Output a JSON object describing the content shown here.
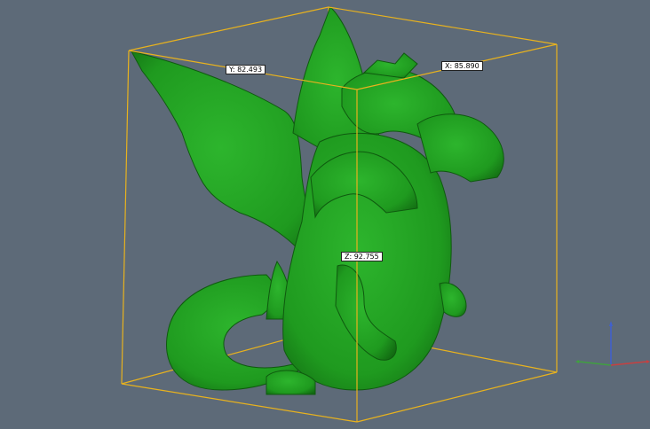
{
  "viewport": {
    "background_color": "#5d6a78",
    "model_color": "#1f9a1f",
    "bbox_color": "#e8b21e"
  },
  "dimensions": {
    "x_label": "X: 85.890",
    "y_label": "Y: 82.493",
    "z_label": "Z: 92.755"
  },
  "axis_gizmo": {
    "x_color": "#c84040",
    "y_color": "#40a040",
    "z_color": "#4060d0"
  }
}
